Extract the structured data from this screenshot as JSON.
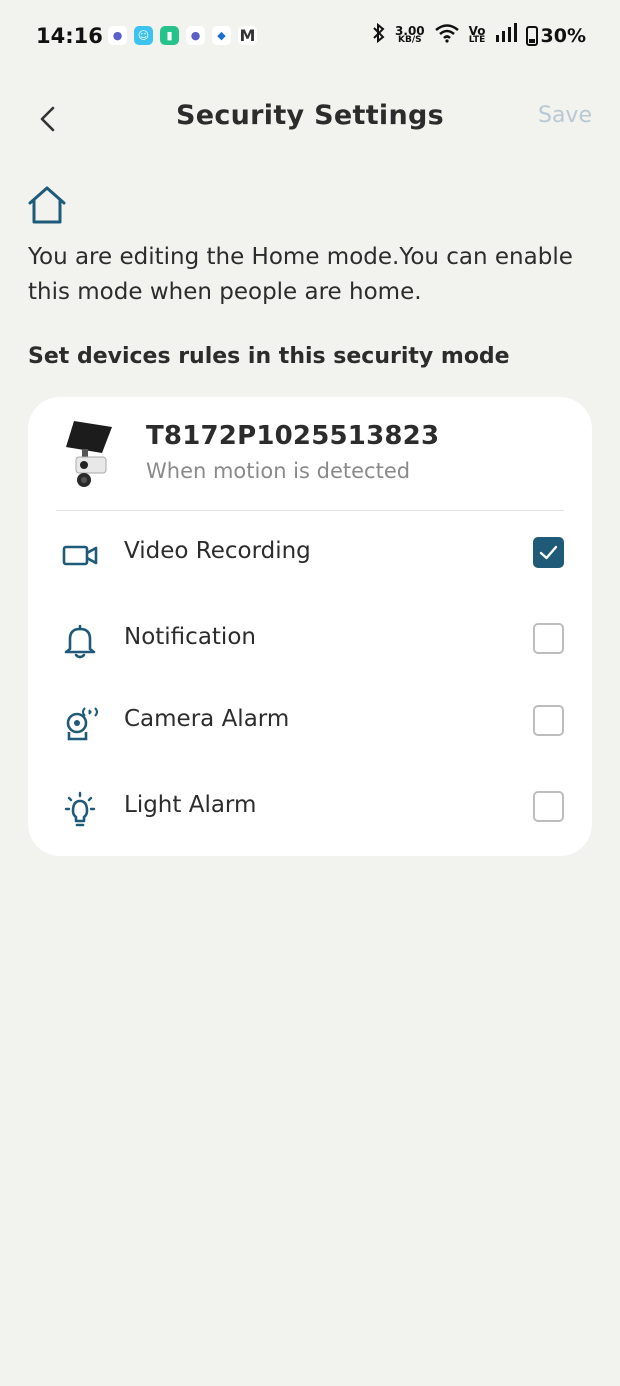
{
  "status_bar": {
    "time": "14:16",
    "net_speed_value": "3.00",
    "net_speed_unit": "KB/S",
    "volte_top": "Vo",
    "volte_bottom": "LTE",
    "battery": "30%",
    "app_icons": [
      "teams-icon",
      "waze-icon",
      "battery-app-icon",
      "teams-icon",
      "layers-app-icon",
      "gmail-icon"
    ]
  },
  "header": {
    "title": "Security Settings",
    "save_label": "Save"
  },
  "mode": {
    "icon": "home-icon",
    "description": "You are editing the Home mode.You can enable this mode when people are home."
  },
  "section": {
    "heading": "Set devices rules in this security mode"
  },
  "device": {
    "name": "T8172P1025513823",
    "trigger": "When motion is detected"
  },
  "rules": [
    {
      "label": "Video Recording",
      "icon": "video-camera-icon",
      "checked": true
    },
    {
      "label": "Notification",
      "icon": "bell-icon",
      "checked": false
    },
    {
      "label": "Camera Alarm",
      "icon": "camera-alarm-icon",
      "checked": false
    },
    {
      "label": "Light Alarm",
      "icon": "light-bulb-icon",
      "checked": false
    }
  ],
  "colors": {
    "accent": "#1f5a78",
    "icon": "#1f5a78",
    "background": "#f2f2ef",
    "save_disabled": "#b9c8d2"
  }
}
